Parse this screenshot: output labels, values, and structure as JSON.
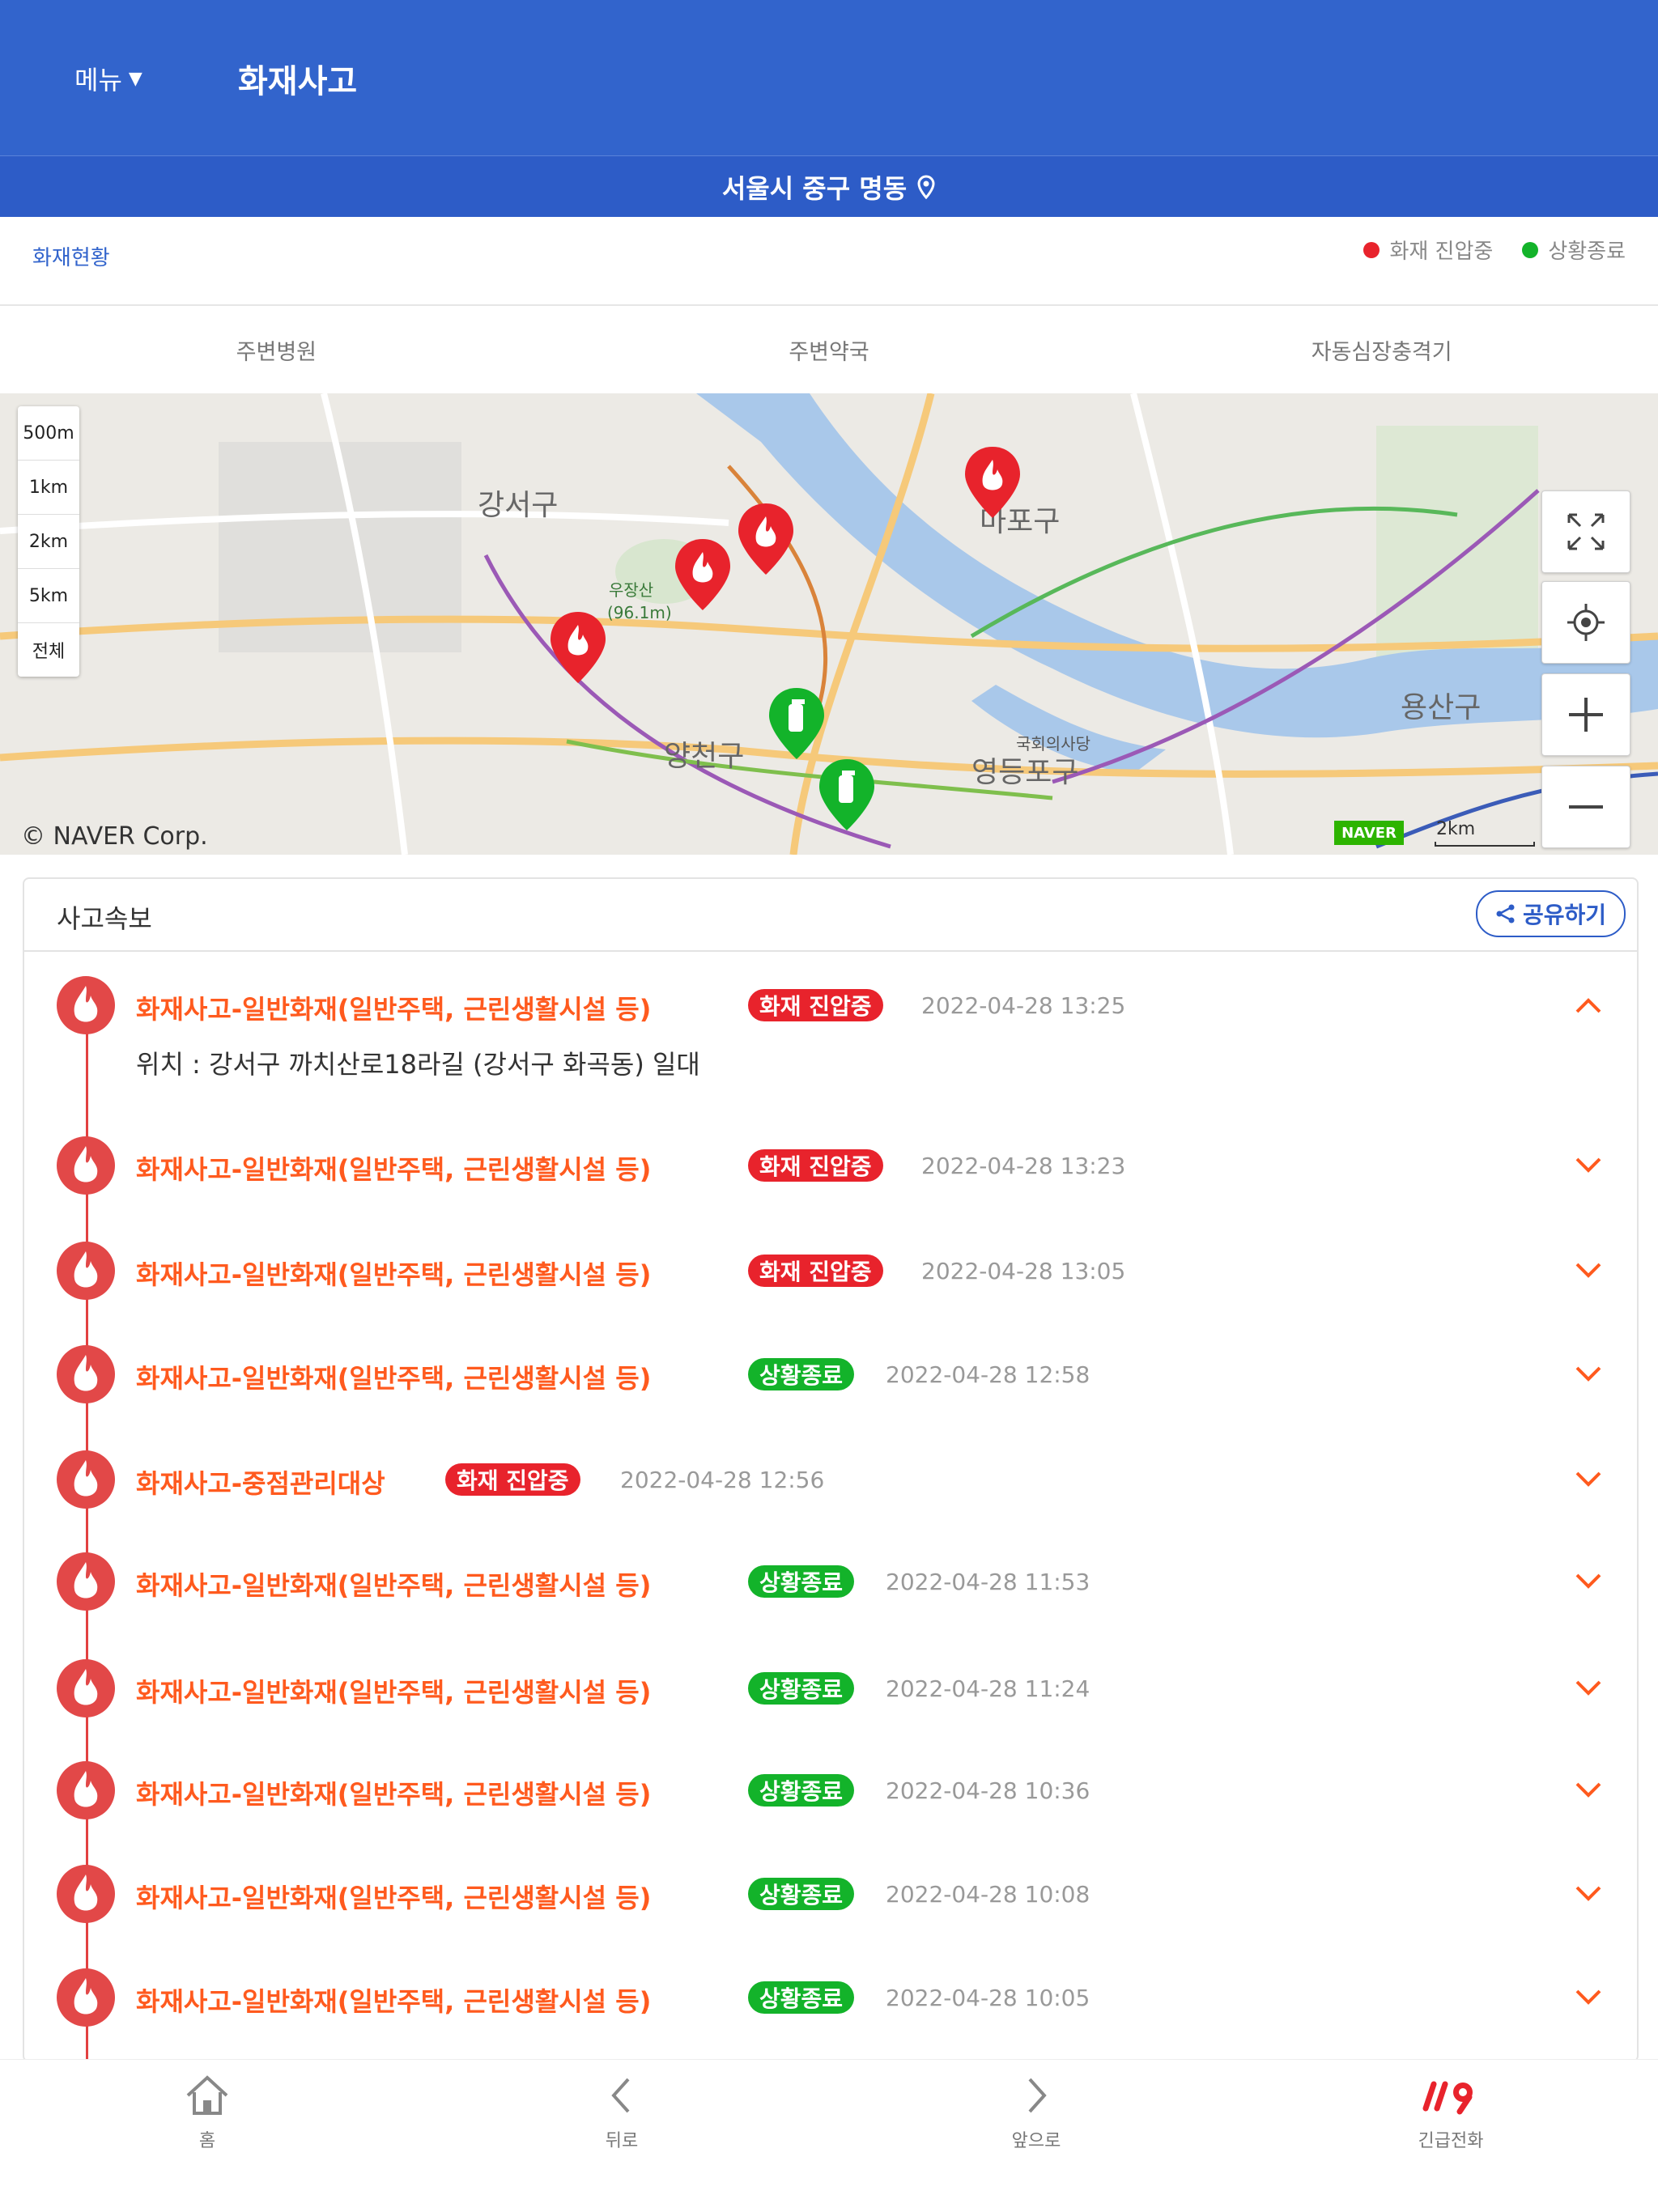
{
  "header": {
    "menu_label": "메뉴",
    "title": "화재사고",
    "location": "서울시 중구 명동"
  },
  "status": {
    "title": "화재현황",
    "legend": [
      {
        "label": "화재 진압중",
        "color": "#e8232c"
      },
      {
        "label": "상황종료",
        "color": "#13b32a"
      }
    ]
  },
  "tabs": [
    "주변병원",
    "주변약국",
    "자동심장충격기"
  ],
  "map": {
    "scales": [
      "500m",
      "1km",
      "2km",
      "5km",
      "전체"
    ],
    "attribution": "© NAVER Corp.",
    "logo": "NAVER",
    "scalebar_label": "2km",
    "labels": {
      "gangseo": "강서구",
      "mapo": "마포구",
      "yangcheon": "양천구",
      "yeongdeungpo": "영등포구",
      "yongsan": "용산구",
      "useonsan": "우장산",
      "elev": "(96.1m)",
      "gukhoe": "국회의사당"
    },
    "controls": [
      "fullscreen-icon",
      "my-location-icon",
      "zoom-in-icon",
      "zoom-out-icon"
    ]
  },
  "panel": {
    "title": "사고속보",
    "share_label": "공유하기",
    "detail": "위치 : 강서구 까치산로18라길 (강서구 화곡동) 일대",
    "incidents": [
      {
        "title": "화재사고-일반화재(일반주택, 근린생활시설 등)",
        "status": "화재 진압중",
        "status_type": "red",
        "time": "2022-04-28 13:25",
        "expanded": true
      },
      {
        "title": "화재사고-일반화재(일반주택, 근린생활시설 등)",
        "status": "화재 진압중",
        "status_type": "red",
        "time": "2022-04-28 13:23",
        "expanded": false
      },
      {
        "title": "화재사고-일반화재(일반주택, 근린생활시설 등)",
        "status": "화재 진압중",
        "status_type": "red",
        "time": "2022-04-28 13:05",
        "expanded": false
      },
      {
        "title": "화재사고-일반화재(일반주택, 근린생활시설 등)",
        "status": "상황종료",
        "status_type": "green",
        "time": "2022-04-28 12:58",
        "expanded": false
      },
      {
        "title": "화재사고-중점관리대상",
        "status": "화재 진압중",
        "status_type": "red",
        "time": "2022-04-28 12:56",
        "expanded": false
      },
      {
        "title": "화재사고-일반화재(일반주택, 근린생활시설 등)",
        "status": "상황종료",
        "status_type": "green",
        "time": "2022-04-28 11:53",
        "expanded": false
      },
      {
        "title": "화재사고-일반화재(일반주택, 근린생활시설 등)",
        "status": "상황종료",
        "status_type": "green",
        "time": "2022-04-28 11:24",
        "expanded": false
      },
      {
        "title": "화재사고-일반화재(일반주택, 근린생활시설 등)",
        "status": "상황종료",
        "status_type": "green",
        "time": "2022-04-28 10:36",
        "expanded": false
      },
      {
        "title": "화재사고-일반화재(일반주택, 근린생활시설 등)",
        "status": "상황종료",
        "status_type": "green",
        "time": "2022-04-28 10:08",
        "expanded": false
      },
      {
        "title": "화재사고-일반화재(일반주택, 근린생활시설 등)",
        "status": "상황종료",
        "status_type": "green",
        "time": "2022-04-28 10:05",
        "expanded": false
      }
    ]
  },
  "bottom_nav": [
    {
      "label": "홈",
      "icon": "home-icon"
    },
    {
      "label": "뒤로",
      "icon": "back-icon"
    },
    {
      "label": "앞으로",
      "icon": "forward-icon"
    },
    {
      "label": "긴급전화",
      "icon": "emergency-119-icon"
    }
  ],
  "colors": {
    "brand": "#3264cc",
    "fire_active": "#e8232c",
    "resolved": "#13b32a",
    "title_orange": "#ff5a1e"
  }
}
